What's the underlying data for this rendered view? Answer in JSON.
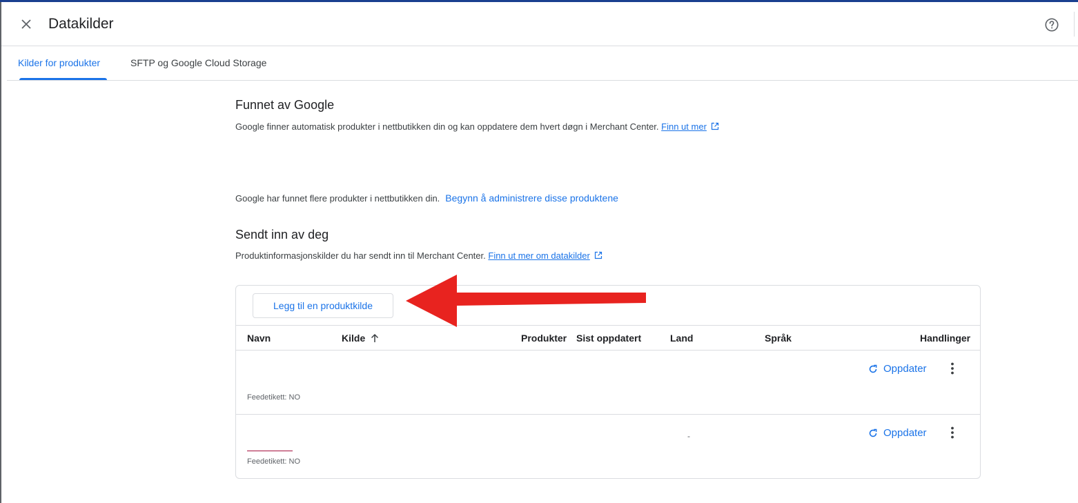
{
  "header": {
    "title": "Datakilder"
  },
  "tabs": [
    {
      "label": "Kilder for produkter",
      "active": true
    },
    {
      "label": "SFTP og Google Cloud Storage",
      "active": false
    }
  ],
  "found_by_google": {
    "title": "Funnet av Google",
    "description": "Google finner automatisk produkter i nettbutikken din og kan oppdatere dem hvert døgn i Merchant Center.",
    "learn_more": "Finn ut mer",
    "found_more_text": "Google har funnet flere produkter i nettbutikken din.",
    "start_managing": "Begynn å administrere disse produktene"
  },
  "submitted_by_you": {
    "title": "Sendt inn av deg",
    "description": "Produktinformasjonskilder du har sendt inn til Merchant Center.",
    "learn_more": "Finn ut mer om datakilder"
  },
  "card": {
    "add_button": "Legg til en produktkilde",
    "columns": {
      "name": "Navn",
      "source": "Kilde",
      "products": "Produkter",
      "last_updated": "Sist oppdatert",
      "country": "Land",
      "language": "Språk",
      "actions": "Handlinger"
    },
    "rows": [
      {
        "feed_label": "Feedetikett: NO",
        "update_label": "Oppdater",
        "last_updated": ""
      },
      {
        "feed_label": "Feedetikett: NO",
        "update_label": "Oppdater",
        "last_updated": "-"
      }
    ]
  },
  "colors": {
    "accent": "#1a73e8",
    "arrow": "#e8231f",
    "top_bar": "#1a3f8f"
  }
}
